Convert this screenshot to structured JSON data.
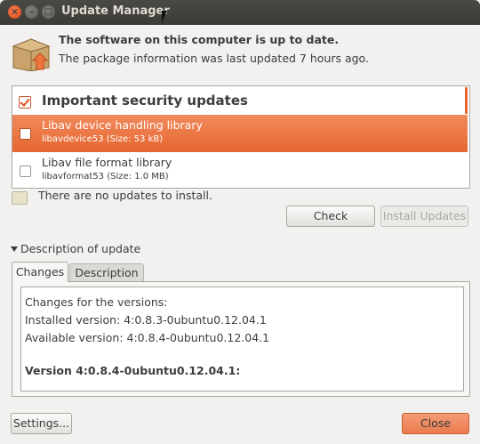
{
  "window": {
    "title": "Update Manager"
  },
  "header": {
    "status_title": "The software on this computer is up to date.",
    "status_subtitle": "The package information was last updated 7 hours ago."
  },
  "updates": {
    "group_label": "Important security updates",
    "group_checked": true,
    "items": [
      {
        "name": "Libav device handling library",
        "meta": "libavdevice53 (Size: 53 kB)",
        "checked": false,
        "selected": true
      },
      {
        "name": "Libav file format library",
        "meta": "libavformat53 (Size: 1.0 MB)",
        "checked": false,
        "selected": false
      }
    ]
  },
  "info": {
    "message": "There are no updates to install."
  },
  "buttons": {
    "check": "Check",
    "install": "Install Updates",
    "settings": "Settings...",
    "close": "Close"
  },
  "description": {
    "expander_label": "Description of update",
    "tabs": [
      "Changes",
      "Description"
    ],
    "active_tab": "Changes",
    "lines": [
      "Changes for the versions:",
      "Installed version: 4:0.8.3-0ubuntu0.12.04.1",
      "Available version: 4:0.8.4-0ubuntu0.12.04.1",
      "",
      "Version 4:0.8.4-0ubuntu0.12.04.1:"
    ]
  },
  "colors": {
    "accent": "#e5662f",
    "titlebar": "#3c3b37",
    "window_bg": "#f2f1f0"
  }
}
